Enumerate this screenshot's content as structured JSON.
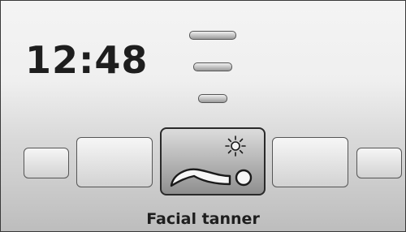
{
  "display": {
    "clock": "12:48",
    "program_label": "Facial tanner"
  },
  "icons": {
    "level_indicator": "intensity-bars-icon",
    "selected_program": "face-sun-icon"
  }
}
